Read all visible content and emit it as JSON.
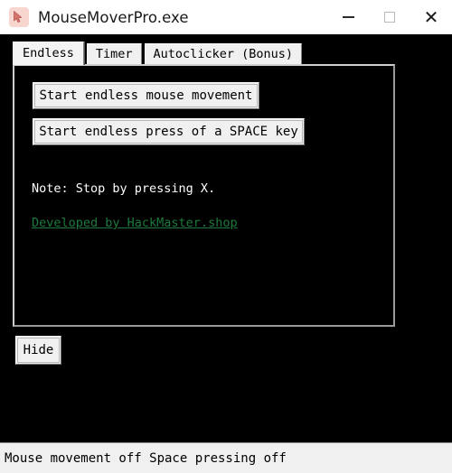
{
  "window": {
    "title": "MouseMoverPro.exe",
    "app_icon": "mouse-cursor-icon",
    "controls": {
      "minimize_label": "—",
      "maximize_label": "",
      "close_label": "✕"
    }
  },
  "tabs": [
    {
      "label": "Endless",
      "active": true
    },
    {
      "label": "Timer",
      "active": false
    },
    {
      "label": "Autoclicker (Bonus)",
      "active": false
    }
  ],
  "panel": {
    "buttons": [
      {
        "label": "Start endless mouse movement"
      },
      {
        "label": "Start endless press of a SPACE key"
      }
    ],
    "note": "Note: Stop by pressing X.",
    "link": "Developed by HackMaster.shop"
  },
  "hide_button": {
    "label": "Hide"
  },
  "statusbar": {
    "text": "Mouse movement off Space pressing off"
  },
  "colors": {
    "client_background": "#000000",
    "titlebar_background": "#ffffff",
    "button_face": "#f0f0f0",
    "note_text": "#ffffff",
    "link_text": "#1d7a3d",
    "app_icon_background": "#f7d6d0",
    "statusbar_background": "#f0f0f0"
  }
}
